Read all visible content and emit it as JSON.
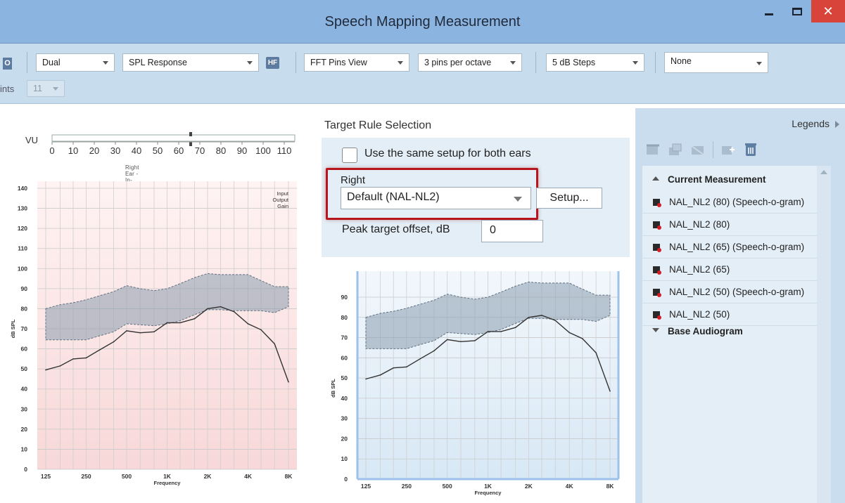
{
  "window": {
    "title": "Speech Mapping Measurement",
    "minimize_glyph": "_",
    "maximize_glyph": "☐",
    "close_glyph": "✕",
    "accent_color": "#8cb4e0",
    "close_color": "#d9443a"
  },
  "toolbar": {
    "cut_left_label": "O",
    "points_label": "ints",
    "points_value": "11",
    "mode_value": "Dual",
    "response_value": "SPL Response",
    "hf_badge": "HF",
    "view_value": "FFT Pins View",
    "pins_value": "3 pins per octave",
    "steps_value": "5 dB Steps",
    "extra_value": "None"
  },
  "vu": {
    "label": "VU",
    "ticks": [
      "0",
      "10",
      "20",
      "30",
      "40",
      "50",
      "60",
      "70",
      "80",
      "90",
      "100",
      "110"
    ],
    "caption": "Right Ear - In-situ"
  },
  "left_chart": {
    "legend_lines": [
      "Input",
      "Output",
      "Gain"
    ],
    "background": "#fbe6e6"
  },
  "right_chart": {
    "background": "#e3eef8"
  },
  "chart_data": {
    "type": "line",
    "ylabel": "dB SPL",
    "xlabel": "Frequency",
    "x_ticks": [
      "125",
      "250",
      "500",
      "1K",
      "2K",
      "4K",
      "8K"
    ],
    "y_ticks_left": [
      "0",
      "10",
      "20",
      "30",
      "40",
      "50",
      "60",
      "70",
      "80",
      "90",
      "100",
      "110",
      "120",
      "130",
      "140"
    ],
    "y_ticks_right": [
      "0",
      "10",
      "20",
      "30",
      "40",
      "50",
      "60",
      "70",
      "80",
      "90"
    ],
    "ylim": [
      0,
      140
    ],
    "x_scale": "log",
    "frequencies": [
      125,
      160,
      200,
      250,
      315,
      400,
      500,
      630,
      800,
      1000,
      1250,
      1600,
      2000,
      2500,
      3150,
      4000,
      5000,
      6300,
      8000
    ],
    "series": [
      {
        "values": [
          49.5,
          51.5,
          55.0,
          55.5,
          59.5,
          63.5,
          69.0,
          68.0,
          68.5,
          73.0,
          73.0,
          75.0,
          80.0,
          81.0,
          78.5,
          72.5,
          69.5,
          62.5,
          43.5
        ]
      },
      {
        "values": [
          80.0,
          82.0,
          83.0,
          84.5,
          86.5,
          88.5,
          91.5,
          90.0,
          89.0,
          90.0,
          92.5,
          95.5,
          97.5,
          97.0,
          97.0,
          97.0,
          94.0,
          91.0,
          91.0
        ]
      },
      {
        "values": [
          64.5,
          64.5,
          64.5,
          64.5,
          66.5,
          68.5,
          72.5,
          72.0,
          71.5,
          72.5,
          74.0,
          77.0,
          79.5,
          79.5,
          79.0,
          79.0,
          79.0,
          78.0,
          81.0
        ]
      }
    ]
  },
  "target_rule": {
    "title": "Target Rule Selection",
    "same_setup_label": "Use the same setup for both ears",
    "same_setup_checked": false,
    "ear_label": "Right",
    "rule_value": "Default (NAL-NL2)",
    "setup_label": "Setup...",
    "offset_label": "Peak target offset, dB",
    "offset_value": "0",
    "highlight_color": "#b8161c"
  },
  "legends": {
    "title": "Legends",
    "groups": {
      "current": "Current Measurement",
      "base": "Base Audiogram"
    },
    "items": [
      {
        "label": "NAL_NL2 (80) (Speech-o-gram)"
      },
      {
        "label": "NAL_NL2 (80)"
      },
      {
        "label": "NAL_NL2 (65) (Speech-o-gram)"
      },
      {
        "label": "NAL_NL2 (65)"
      },
      {
        "label": "NAL_NL2 (50) (Speech-o-gram)"
      },
      {
        "label": "NAL_NL2 (50)"
      }
    ],
    "tool_icons": [
      "layer-icon",
      "layer-add-icon",
      "layer-alt-icon",
      "import-icon",
      "delete-icon"
    ]
  }
}
